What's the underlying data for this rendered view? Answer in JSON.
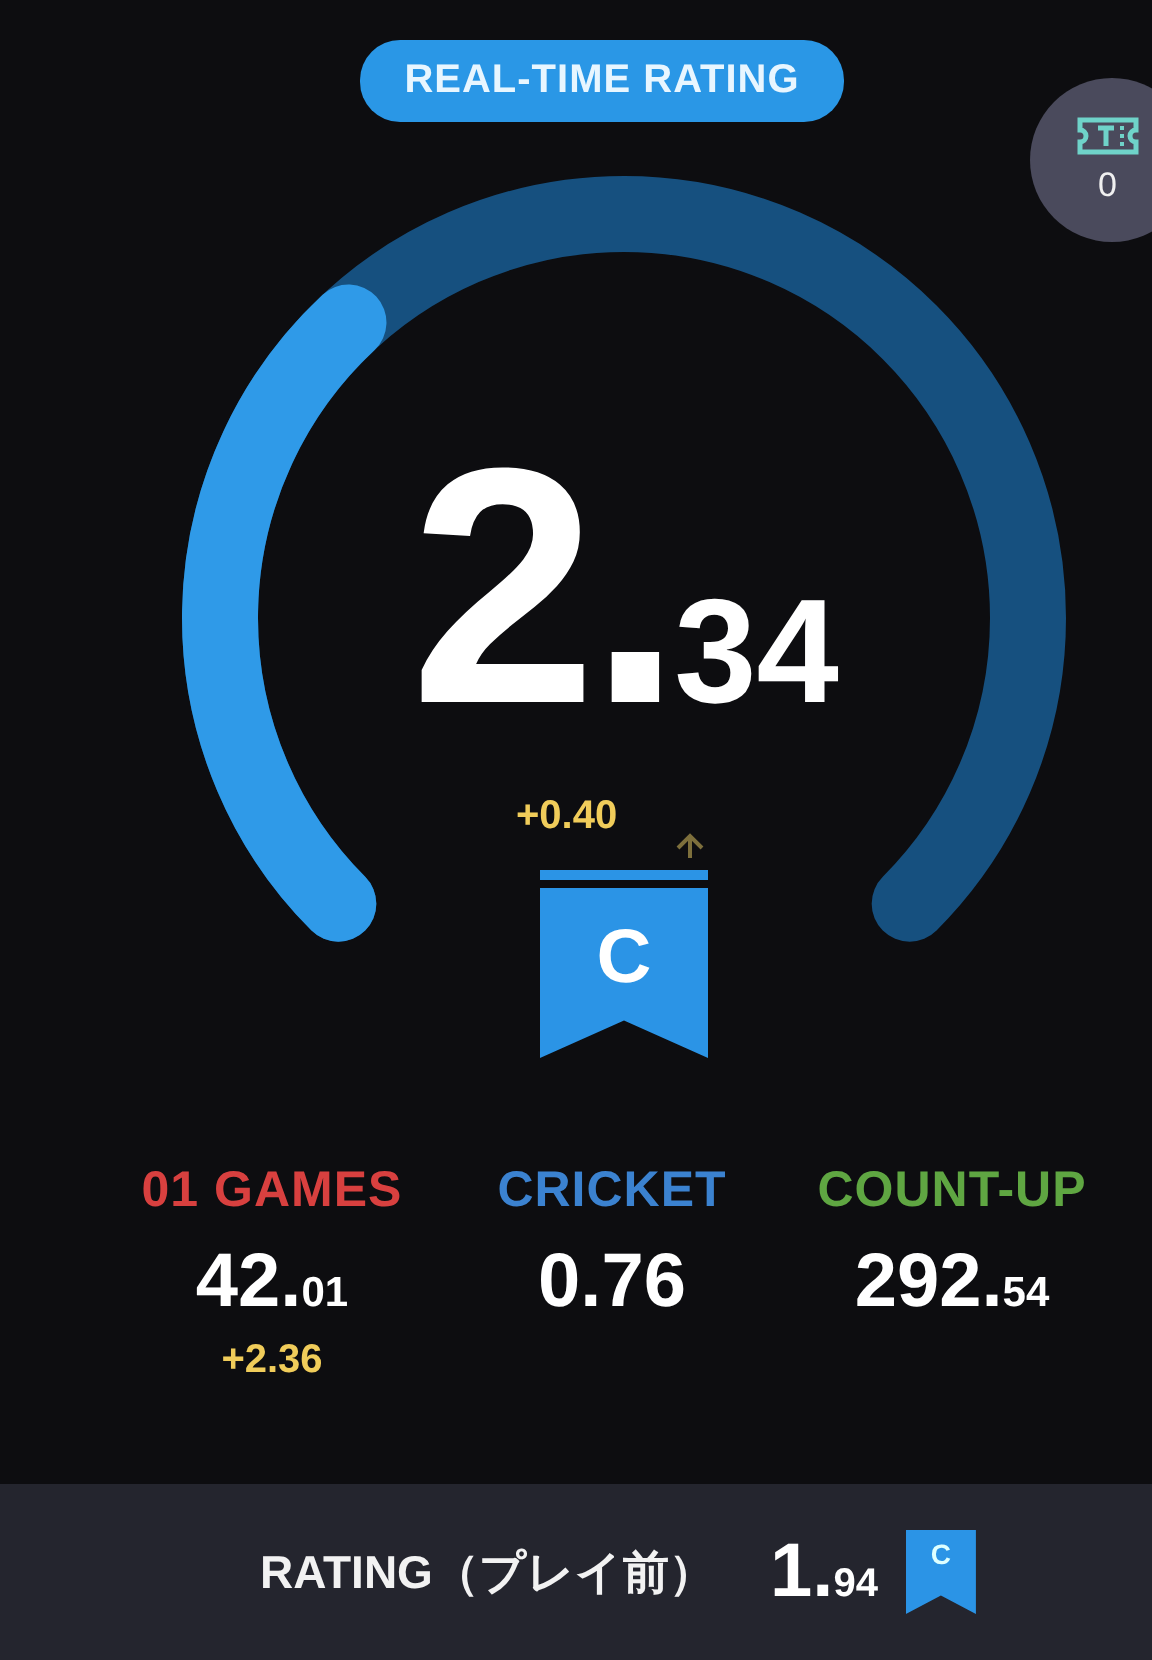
{
  "header": {
    "title": "REAL-TIME RATING"
  },
  "ticket": {
    "count": "0"
  },
  "gauge": {
    "whole": "2.",
    "fraction": "34",
    "change": "+0.40"
  },
  "rank": {
    "letter": "C"
  },
  "stats": [
    {
      "label": "01 GAMES",
      "color": "#d8403f",
      "whole": "42.",
      "fraction": "01",
      "change": "+2.36"
    },
    {
      "label": "CRICKET",
      "color": "#3b82d0",
      "whole": "0.76"
    },
    {
      "label": "COUNT-UP",
      "color": "#5fa642",
      "whole": "292.",
      "fraction": "54"
    }
  ],
  "footer": {
    "label": "RATING（プレイ前）",
    "whole": "1.",
    "fraction": "94",
    "rank": "C"
  }
}
